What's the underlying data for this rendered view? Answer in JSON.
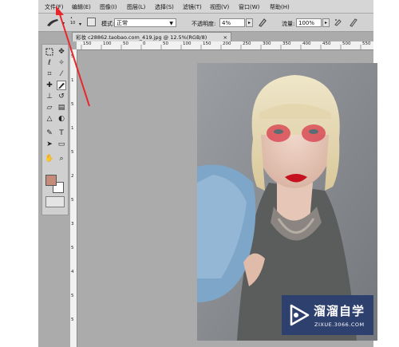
{
  "menu": {
    "items": [
      {
        "label": "文件(F)"
      },
      {
        "label": "编辑(E)"
      },
      {
        "label": "图像(I)"
      },
      {
        "label": "图层(L)"
      },
      {
        "label": "选择(S)"
      },
      {
        "label": "滤镜(T)"
      },
      {
        "label": "视图(V)"
      },
      {
        "label": "窗口(W)"
      },
      {
        "label": "帮助(H)"
      }
    ]
  },
  "options": {
    "brush_size": "10",
    "mode_label": "模式:",
    "mode_value": "正常",
    "opacity_label": "不透明度:",
    "opacity_value": "4%",
    "flow_label": "流量:",
    "flow_value": "100%"
  },
  "document": {
    "tab_title": "彩妆 c28862.taobao.com_419.jpg @ 12.5%(RGB/8)",
    "close_glyph": "×"
  },
  "ruler": {
    "top_ticks": [
      "150",
      "100",
      "50",
      "0",
      "50",
      "100",
      "150",
      "200",
      "250",
      "300",
      "350",
      "400",
      "450",
      "500",
      "550"
    ],
    "left_ticks": [
      "5",
      "1",
      "5",
      "1",
      "5",
      "2",
      "5",
      "3",
      "5",
      "4",
      "5",
      "5"
    ]
  },
  "watermark": {
    "title": "溜溜自学",
    "url": "ZIXUE.3066.COM"
  },
  "colors": {
    "foreground": "#c58b7a",
    "background": "#ffffff",
    "annotation_arrow": "#e8262b",
    "watermark_bg": "#2d406e"
  },
  "icons": [
    "brush-icon",
    "marquee-icon",
    "move-icon",
    "lasso-icon",
    "magic-wand-icon",
    "crop-icon",
    "eyedropper-icon",
    "healing-icon",
    "brush-tool-icon",
    "stamp-icon",
    "history-brush-icon",
    "eraser-icon",
    "gradient-icon",
    "dodge-icon",
    "pen-icon",
    "type-icon",
    "path-select-icon",
    "shape-icon",
    "hand-icon",
    "zoom-icon",
    "airbrush-icon",
    "tablet-pressure-icon",
    "play-logo-icon"
  ]
}
